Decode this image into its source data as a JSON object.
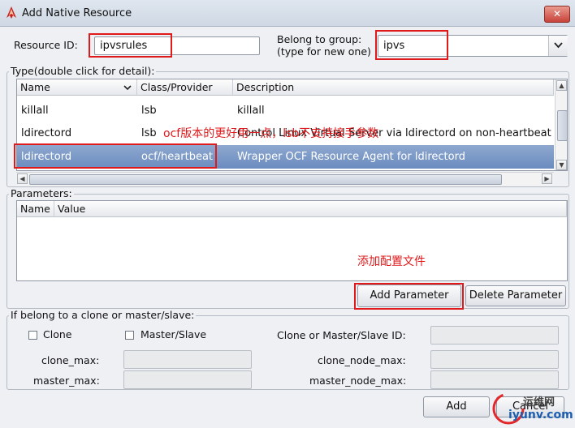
{
  "window": {
    "title": "Add Native Resource",
    "close_label": "✕"
  },
  "form": {
    "resource_id_label": "Resource ID:",
    "resource_id_value": "ipvsrules",
    "group_label_1": "Belong to group:",
    "group_label_2": "(type for new one)",
    "group_value": "ipvs"
  },
  "type_table": {
    "group_title": "Type(double click for detail):",
    "headers": [
      "Name",
      "Class/Provider",
      "Description"
    ],
    "rows": [
      {
        "name": "killall",
        "provider": "lsb",
        "description": "killall"
      },
      {
        "name": "ldirectord",
        "provider": "lsb",
        "description": "Control Linux Virtual Server via ldirectord on non-heartbeat s"
      },
      {
        "name": "ldirectord",
        "provider": "ocf/heartbeat",
        "description": "Wrapper OCF Resource Agent for ldirectord",
        "selected": true
      }
    ]
  },
  "parameters": {
    "group_title": "Parameters:",
    "headers": [
      "Name",
      "Value"
    ],
    "add_button": "Add Parameter",
    "delete_button": "Delete Parameter"
  },
  "clone": {
    "group_title": "If belong to a clone or master/slave:",
    "clone_checkbox": "Clone",
    "master_slave_checkbox": "Master/Slave",
    "clone_id_label": "Clone or Master/Slave ID:",
    "clone_max_label": "clone_max:",
    "master_max_label": "master_max:",
    "clone_node_max_label": "clone_node_max:",
    "master_node_max_label": "master_node_max:"
  },
  "footer": {
    "add_button": "Add",
    "cancel_button": "Cancel"
  },
  "annotations": {
    "ocf_note": "ocf版本的更好用一点，lsb不支持接手参数",
    "config_note": "添加配置文件"
  },
  "watermark": {
    "line1": "运维网",
    "line2": "iyunv.com"
  },
  "colors": {
    "selection": "#7592c6",
    "annotation_red": "#e0191b",
    "window_bg": "#eef0f4"
  }
}
